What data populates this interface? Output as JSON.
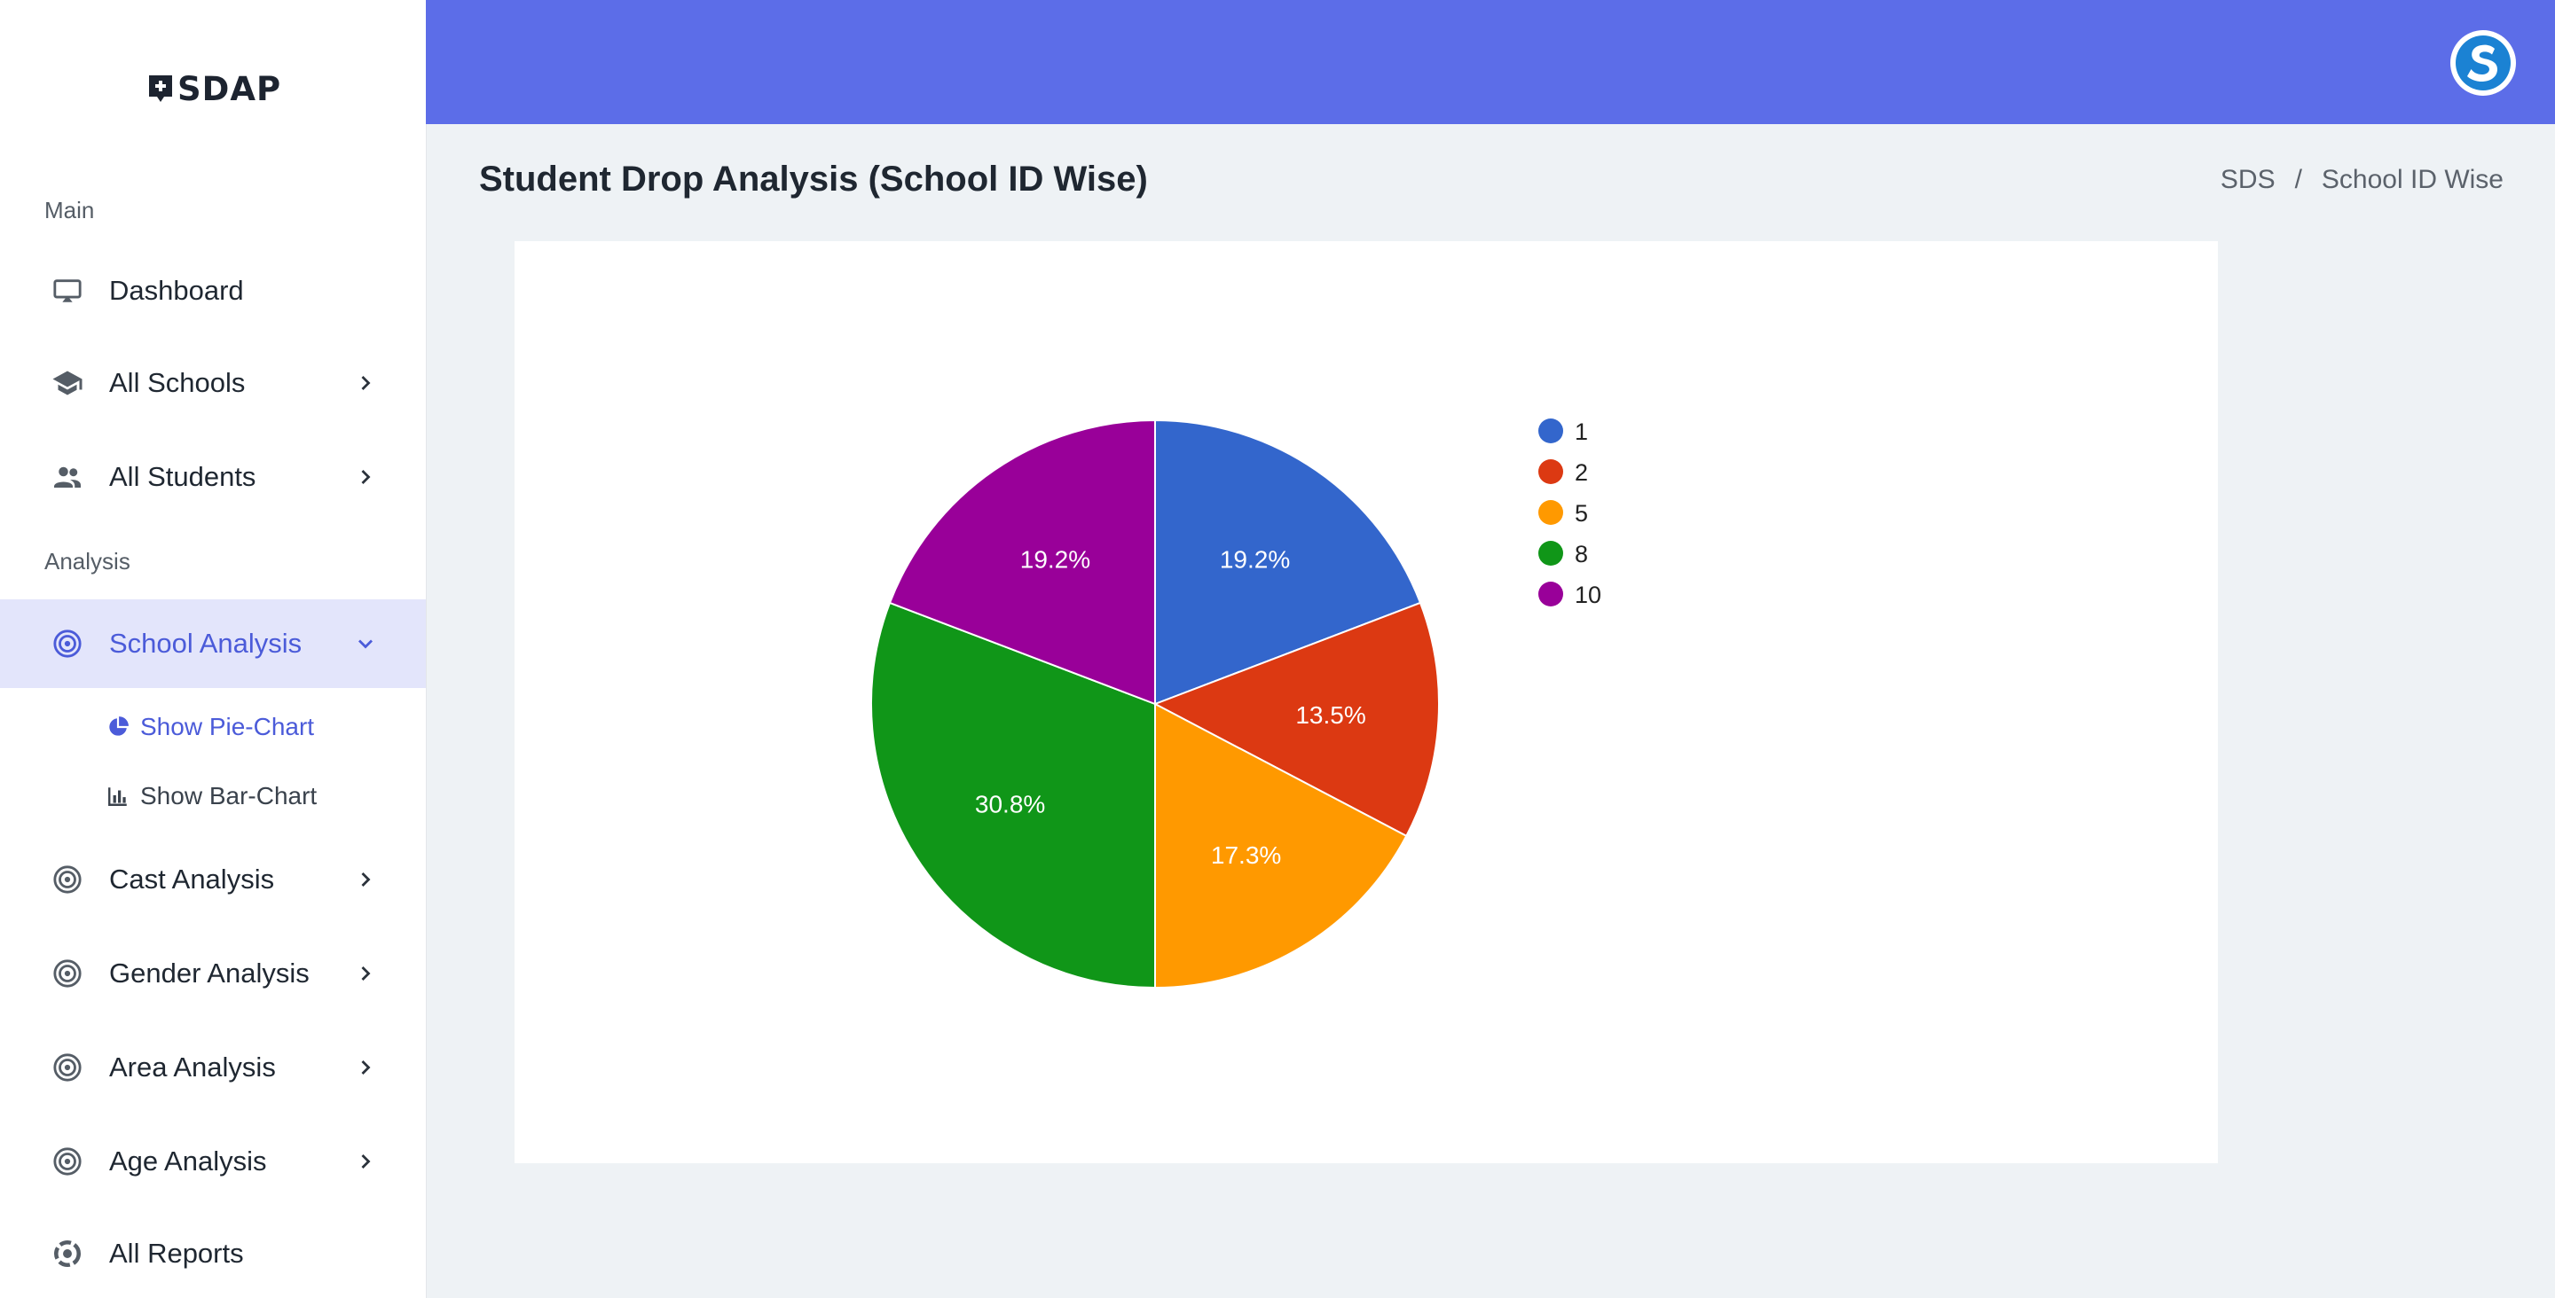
{
  "app": {
    "brand": "SDAP"
  },
  "sidebar": {
    "sections": {
      "main": "Main",
      "analysis": "Analysis"
    },
    "items": {
      "dashboard": "Dashboard",
      "all_schools": "All Schools",
      "all_students": "All Students",
      "school_analysis": "School Analysis",
      "show_pie_chart": "Show Pie-Chart",
      "show_bar_chart": "Show Bar-Chart",
      "cast_analysis": "Cast Analysis",
      "gender_analysis": "Gender Analysis",
      "area_analysis": "Area Analysis",
      "age_analysis": "Age Analysis",
      "all_reports": "All Reports"
    }
  },
  "page": {
    "title": "Student Drop Analysis (School ID Wise)"
  },
  "breadcrumb": {
    "root": "SDS",
    "separator": "/",
    "current": "School ID Wise"
  },
  "colors": {
    "accent": "#5c6de8",
    "active_bg": "#e3e5fb",
    "active_text": "#4b5bd9"
  },
  "chart_data": {
    "type": "pie",
    "categories": [
      "1",
      "2",
      "5",
      "8",
      "10"
    ],
    "values": [
      19.2,
      13.5,
      17.3,
      30.8,
      19.2
    ],
    "labels": [
      "19.2%",
      "13.5%",
      "17.3%",
      "30.8%",
      "19.2%"
    ],
    "colors": [
      "#3366cc",
      "#dc3912",
      "#ff9900",
      "#109618",
      "#990099"
    ],
    "legend": "right"
  }
}
